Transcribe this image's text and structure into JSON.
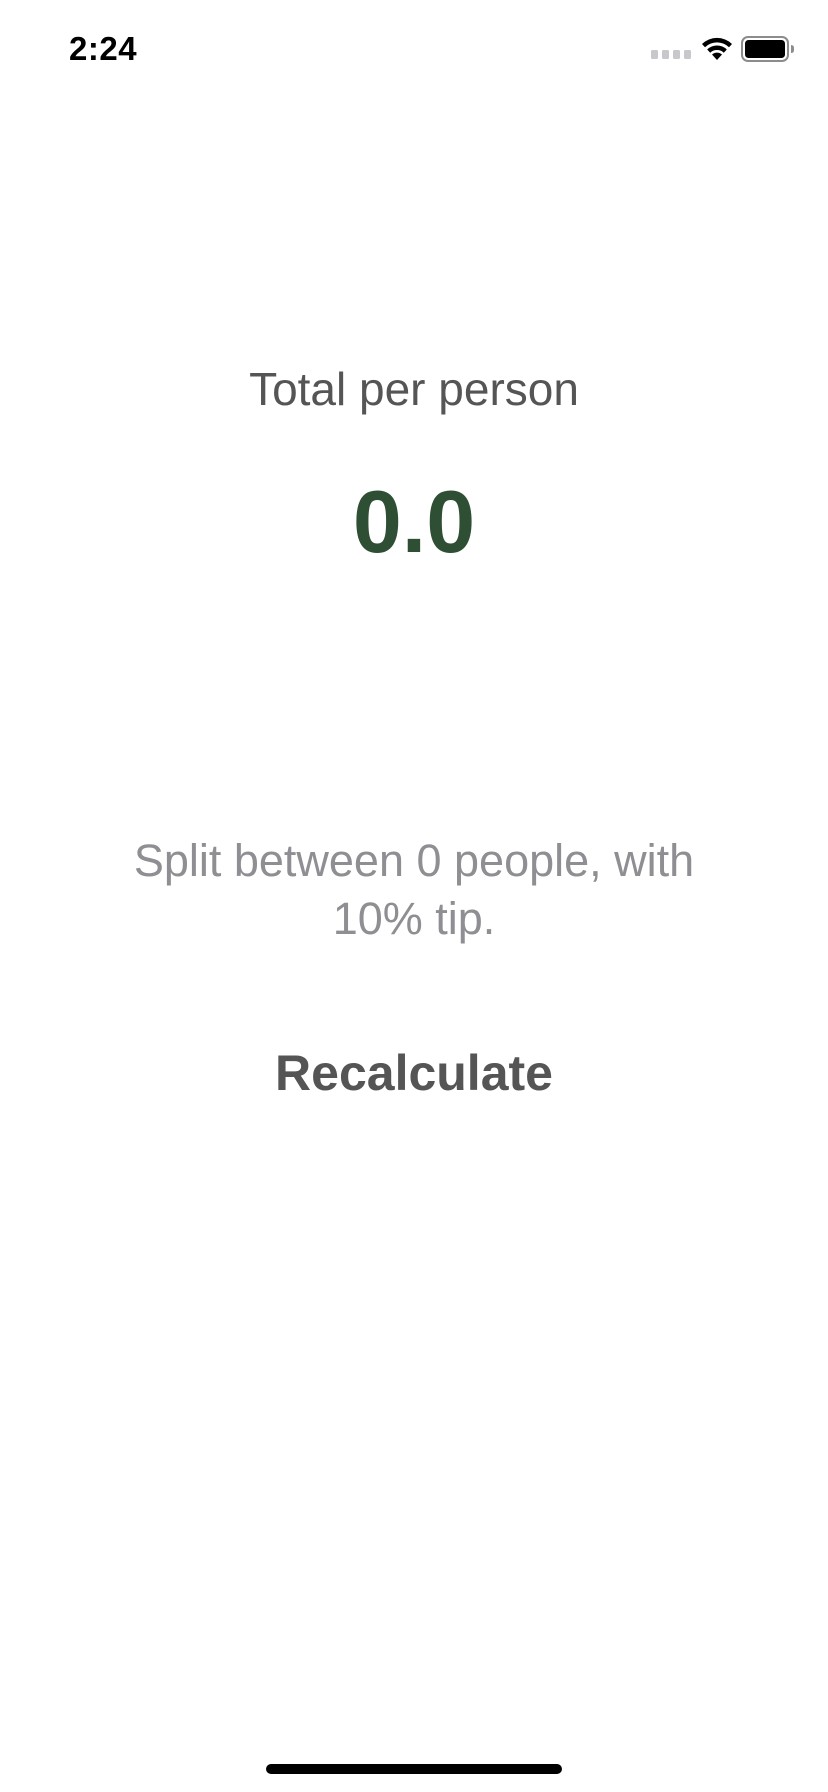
{
  "status_bar": {
    "time": "2:24",
    "icons": [
      "cell-signal-icon",
      "wifi-icon",
      "battery-icon"
    ]
  },
  "result": {
    "label": "Total per person",
    "value": "0.0",
    "value_color": "#2f4f34"
  },
  "summary": {
    "text": "Split between 0 people, with 10% tip."
  },
  "actions": {
    "recalculate_label": "Recalculate"
  }
}
